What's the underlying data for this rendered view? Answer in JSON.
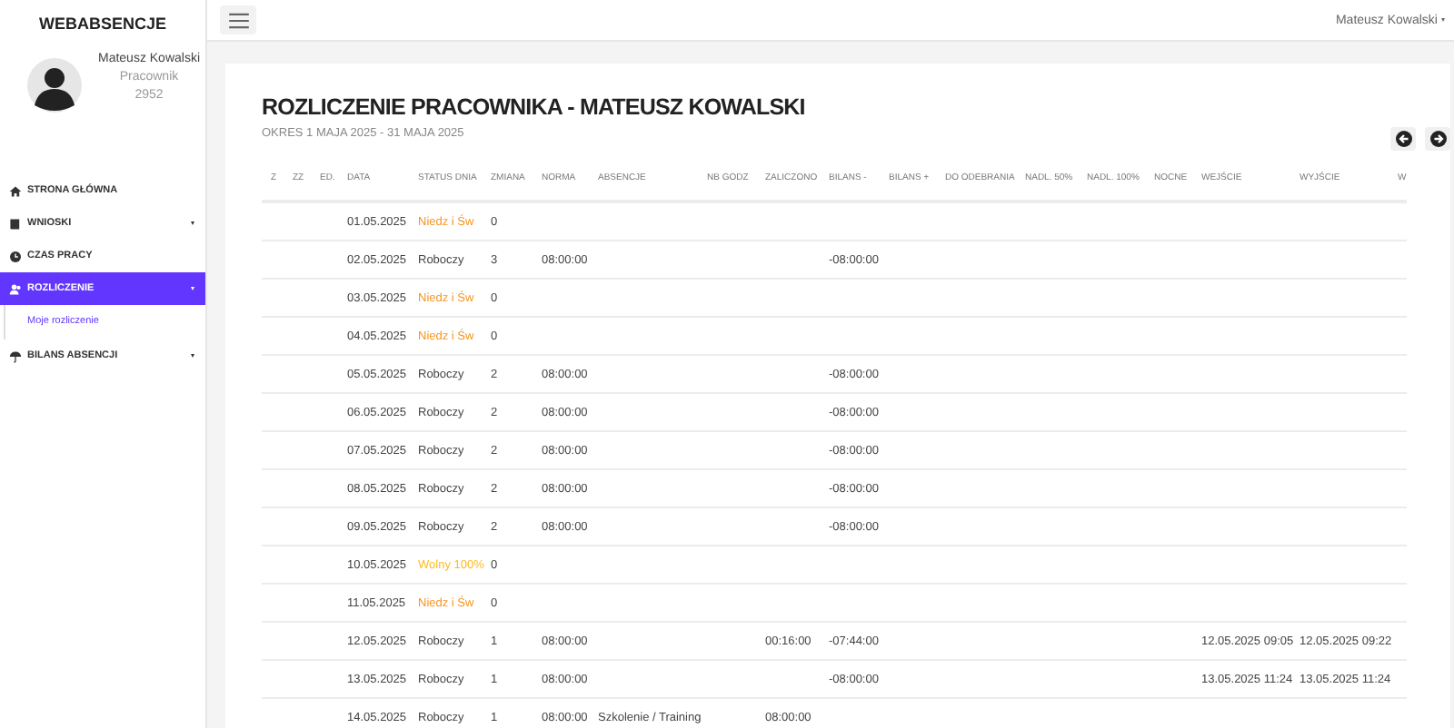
{
  "sidebar": {
    "logo": "WEBABSENCJE",
    "user": {
      "name": "Mateusz Kowalski",
      "role": "Pracownik",
      "id": "2952"
    },
    "items": [
      {
        "label": "STRONA GŁÓWNA",
        "selected": false,
        "expandable": false
      },
      {
        "label": "WNIOSKI",
        "selected": false,
        "expandable": true
      },
      {
        "label": "CZAS PRACY",
        "selected": false,
        "expandable": false
      },
      {
        "label": "ROZLICZENIE",
        "selected": true,
        "expandable": true,
        "children": [
          {
            "label": "Moje rozliczenie",
            "selected": true
          }
        ]
      },
      {
        "label": "BILANS ABSENCJI",
        "selected": false,
        "expandable": true
      }
    ]
  },
  "topbar": {
    "user": "Mateusz Kowalski"
  },
  "page": {
    "title": "ROZLICZENIE PRACOWNIKA - MATEUSZ KOWALSKI",
    "subtitle": "OKRES 1 MAJA 2025 - 31 MAJA 2025"
  },
  "table": {
    "columns": [
      "Z",
      "ZZ",
      "ED.",
      "DATA",
      "STATUS DNIA",
      "ZMIANA",
      "NORMA",
      "ABSENCJE",
      "NB GODZ",
      "ZALICZONO",
      "BILANS -",
      "BILANS +",
      "DO ODEBRANIA",
      "NADL. 50%",
      "NADL. 100%",
      "NOCNE",
      "WEJŚCIE",
      "WYJŚCIE",
      "W"
    ],
    "rows": [
      {
        "date": "01.05.2025",
        "status": {
          "text": "Niedz i Św",
          "color": "#f7941d"
        },
        "shift": "0"
      },
      {
        "date": "02.05.2025",
        "status": {
          "text": "Roboczy",
          "color": "#444444"
        },
        "shift": "3",
        "norm": "08:00:00",
        "balance_minus": "-08:00:00"
      },
      {
        "date": "03.05.2025",
        "status": {
          "text": "Niedz i Św",
          "color": "#f7941d"
        },
        "shift": "0"
      },
      {
        "date": "04.05.2025",
        "status": {
          "text": "Niedz i Św",
          "color": "#f7941d"
        },
        "shift": "0"
      },
      {
        "date": "05.05.2025",
        "status": {
          "text": "Roboczy",
          "color": "#444444"
        },
        "shift": "2",
        "norm": "08:00:00",
        "balance_minus": "-08:00:00"
      },
      {
        "date": "06.05.2025",
        "status": {
          "text": "Roboczy",
          "color": "#444444"
        },
        "shift": "2",
        "norm": "08:00:00",
        "balance_minus": "-08:00:00"
      },
      {
        "date": "07.05.2025",
        "status": {
          "text": "Roboczy",
          "color": "#444444"
        },
        "shift": "2",
        "norm": "08:00:00",
        "balance_minus": "-08:00:00"
      },
      {
        "date": "08.05.2025",
        "status": {
          "text": "Roboczy",
          "color": "#444444"
        },
        "shift": "2",
        "norm": "08:00:00",
        "balance_minus": "-08:00:00"
      },
      {
        "date": "09.05.2025",
        "status": {
          "text": "Roboczy",
          "color": "#444444"
        },
        "shift": "2",
        "norm": "08:00:00",
        "balance_minus": "-08:00:00"
      },
      {
        "date": "10.05.2025",
        "status": {
          "text": "Wolny 100%",
          "color": "#fbbc1f"
        },
        "shift": "0"
      },
      {
        "date": "11.05.2025",
        "status": {
          "text": "Niedz i Św",
          "color": "#f7941d"
        },
        "shift": "0"
      },
      {
        "date": "12.05.2025",
        "status": {
          "text": "Roboczy",
          "color": "#444444"
        },
        "shift": "1",
        "norm": "08:00:00",
        "credited": "00:16:00",
        "balance_minus": "-07:44:00",
        "entry": "12.05.2025 09:05",
        "exit": "12.05.2025 09:22"
      },
      {
        "date": "13.05.2025",
        "status": {
          "text": "Roboczy",
          "color": "#444444"
        },
        "shift": "1",
        "norm": "08:00:00",
        "balance_minus": "-08:00:00",
        "entry": "13.05.2025 11:24",
        "exit": "13.05.2025 11:24"
      },
      {
        "date": "14.05.2025",
        "status": {
          "text": "Roboczy",
          "color": "#444444"
        },
        "shift": "1",
        "norm": "08:00:00",
        "absence": "Szkolenie / Training",
        "credited": "08:00:00"
      }
    ]
  }
}
